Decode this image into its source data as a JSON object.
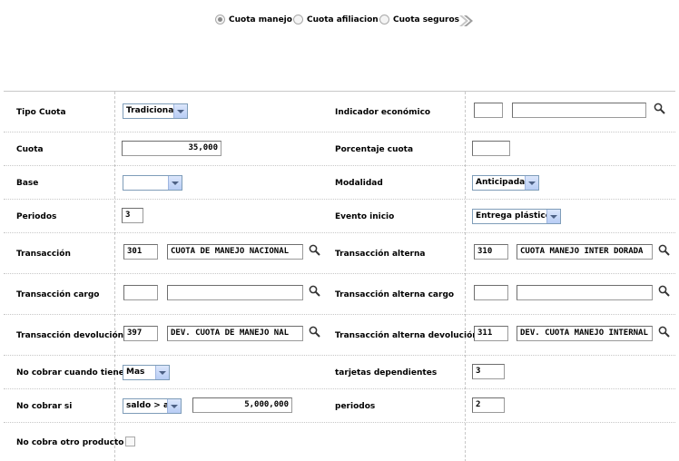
{
  "radio_options": [
    {
      "label": "Cuota manejo",
      "selected": true
    },
    {
      "label": "Cuota afiliacion",
      "selected": false
    },
    {
      "label": "Cuota seguros",
      "selected": false
    }
  ],
  "next_icon": "double-chevron-right-icon",
  "search_icon": "magnifier-icon",
  "form": {
    "tipo_cuota": {
      "label": "Tipo Cuota",
      "value": "Tradicional"
    },
    "indicador_economico": {
      "label": "Indicador económico",
      "code": "",
      "description": ""
    },
    "cuota": {
      "label": "Cuota",
      "value": "35,000"
    },
    "porcentaje_cuota": {
      "label": "Porcentaje cuota",
      "value": ""
    },
    "base": {
      "label": "Base",
      "value": ""
    },
    "modalidad": {
      "label": "Modalidad",
      "value": "Anticipada"
    },
    "periodos": {
      "label": "Periodos",
      "value": "3"
    },
    "evento_inicio": {
      "label": "Evento inicio",
      "value": "Entrega plástico"
    },
    "transaccion": {
      "label": "Transacción",
      "code": "301",
      "description": "CUOTA DE MANEJO NACIONAL"
    },
    "transaccion_alterna": {
      "label": "Transacción alterna",
      "code": "310",
      "description": "CUOTA MANEJO INTER DORADA"
    },
    "transaccion_cargo": {
      "label": "Transacción cargo",
      "code": "",
      "description": ""
    },
    "transaccion_alterna_cargo": {
      "label": "Transacción alterna cargo",
      "code": "",
      "description": ""
    },
    "transaccion_devolucion": {
      "label": "Transacción devolución",
      "code": "397",
      "description": "DEV. CUOTA DE MANEJO NAL"
    },
    "transaccion_alterna_devolucion": {
      "label": "Transacción alterna devolución",
      "code": "311",
      "description": "DEV. CUOTA MANEJO INTERNAL"
    },
    "no_cobrar_cuando_tiene": {
      "label": "No cobrar cuando tiene",
      "value": "Mas"
    },
    "tarjetas_dependientes": {
      "label": "tarjetas dependientes",
      "value": "3"
    },
    "no_cobrar_si": {
      "label": "No cobrar si",
      "condition": "saldo > a",
      "amount": "5,000,000"
    },
    "periodos_2": {
      "label": "periodos",
      "value": "2"
    },
    "no_cobra_otro_producto": {
      "label": "No cobra otro producto",
      "checked": false
    }
  }
}
